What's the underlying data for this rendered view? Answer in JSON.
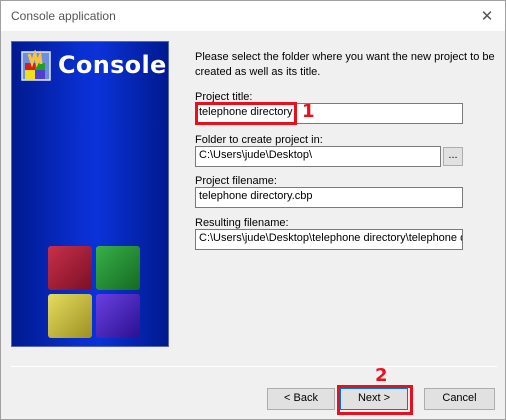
{
  "window": {
    "title": "Console application",
    "close_icon": "close-icon"
  },
  "side_panel": {
    "title": "Console",
    "logo_icon": "codeblocks-logo-icon",
    "cubes_icon": "colored-cubes-icon"
  },
  "intro_text": "Please select the folder where you want the new project to be created as well as its title.",
  "fields": {
    "project_title": {
      "label": "Project title:",
      "value": "telephone directory"
    },
    "folder": {
      "label": "Folder to create project in:",
      "value": "C:\\Users\\jude\\Desktop\\",
      "browse_label": "..."
    },
    "project_filename": {
      "label": "Project filename:",
      "value": "telephone directory.cbp"
    },
    "resulting_filename": {
      "label": "Resulting filename:",
      "value": "C:\\Users\\jude\\Desktop\\telephone directory\\telephone directory.cbp"
    }
  },
  "annotations": {
    "marker_1": "1",
    "marker_2": "2",
    "color": "#e8101c"
  },
  "buttons": {
    "back": "< Back",
    "next": "Next >",
    "cancel": "Cancel"
  }
}
